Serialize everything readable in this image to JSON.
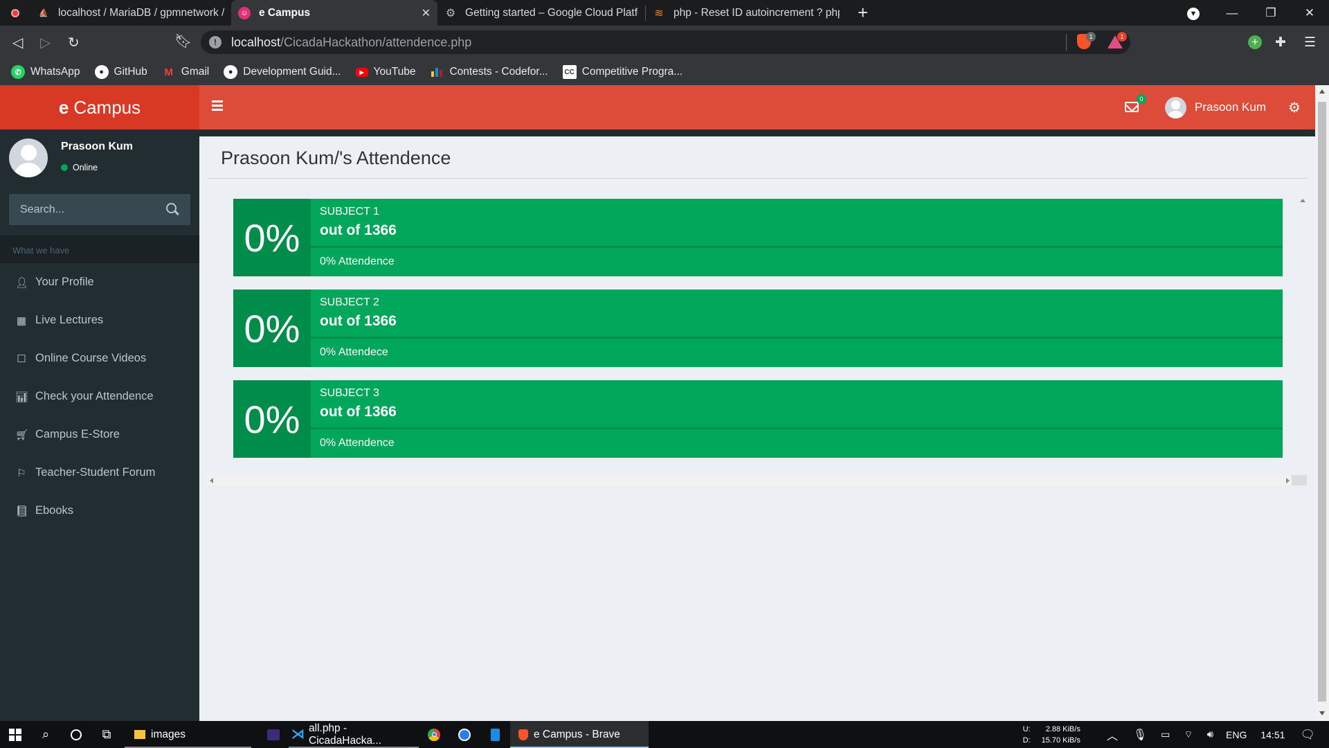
{
  "browser": {
    "tabs": [
      {
        "title": "localhost / MariaDB / gpmnetwork / le",
        "active": false
      },
      {
        "title": "e Campus",
        "active": true
      },
      {
        "title": "Getting started – Google Cloud Platfor",
        "active": false
      },
      {
        "title": "php - Reset ID autoincrement ? phpmy",
        "active": false
      }
    ],
    "url_host": "localhost",
    "url_path": "/CicadaHackathon/attendence.php",
    "shield_count": "1",
    "rewards_count": "1",
    "bookmarks": [
      {
        "label": "WhatsApp",
        "icon": "whatsapp-icon",
        "color": "#25d366"
      },
      {
        "label": "GitHub",
        "icon": "github-icon",
        "color": "#ffffff"
      },
      {
        "label": "Gmail",
        "icon": "gmail-icon",
        "color": "#ea4335"
      },
      {
        "label": "Development Guid...",
        "icon": "github-icon",
        "color": "#ffffff"
      },
      {
        "label": "YouTube",
        "icon": "youtube-icon",
        "color": "#ff0000"
      },
      {
        "label": "Contests - Codefor...",
        "icon": "codeforces-icon",
        "color": "#1f8acb"
      },
      {
        "label": "Competitive Progra...",
        "icon": "codechef-icon",
        "color": "#ffffff"
      }
    ]
  },
  "app": {
    "logo_bold": "e",
    "logo_text": "Campus",
    "mail_count": "0",
    "user_name": "Prasoon Kum",
    "accent": "#dd4b39",
    "success": "#00a65a"
  },
  "sidebar": {
    "user_name": "Prasoon Kum",
    "status": "Online",
    "search_placeholder": "Search...",
    "header": "What we have",
    "items": [
      {
        "label": "Your Profile",
        "icon": "user-icon"
      },
      {
        "label": "Live Lectures",
        "icon": "calendar-icon"
      },
      {
        "label": "Online Course Videos",
        "icon": "square-icon"
      },
      {
        "label": "Check your Attendence",
        "icon": "bar-chart-icon"
      },
      {
        "label": "Campus E-Store",
        "icon": "cart-icon"
      },
      {
        "label": "Teacher-Student Forum",
        "icon": "flag-icon"
      },
      {
        "label": "Ebooks",
        "icon": "book-icon"
      }
    ]
  },
  "main": {
    "title": "Prasoon Kum/'s Attendence",
    "boxes": [
      {
        "percent": "0%",
        "subject": "SUBJECT 1",
        "total": "out of 1366",
        "desc": "0% Attendence"
      },
      {
        "percent": "0%",
        "subject": "SUBJECT 2",
        "total": "out of 1366",
        "desc": "0% Attendece"
      },
      {
        "percent": "0%",
        "subject": "SUBJECT 3",
        "total": "out of 1366",
        "desc": "0% Attendence"
      }
    ]
  },
  "taskbar": {
    "items": [
      {
        "label": "images",
        "icon": "folder-icon"
      },
      {
        "label": "all.php - CicadaHacka...",
        "icon": "vscode-icon"
      },
      {
        "label": "e Campus - Brave",
        "icon": "brave-icon"
      }
    ],
    "upload": "2.88 KiB/s",
    "download": "15.70 KiB/s",
    "upload_label": "U:",
    "download_label": "D:",
    "language": "ENG",
    "time": "14:51"
  }
}
